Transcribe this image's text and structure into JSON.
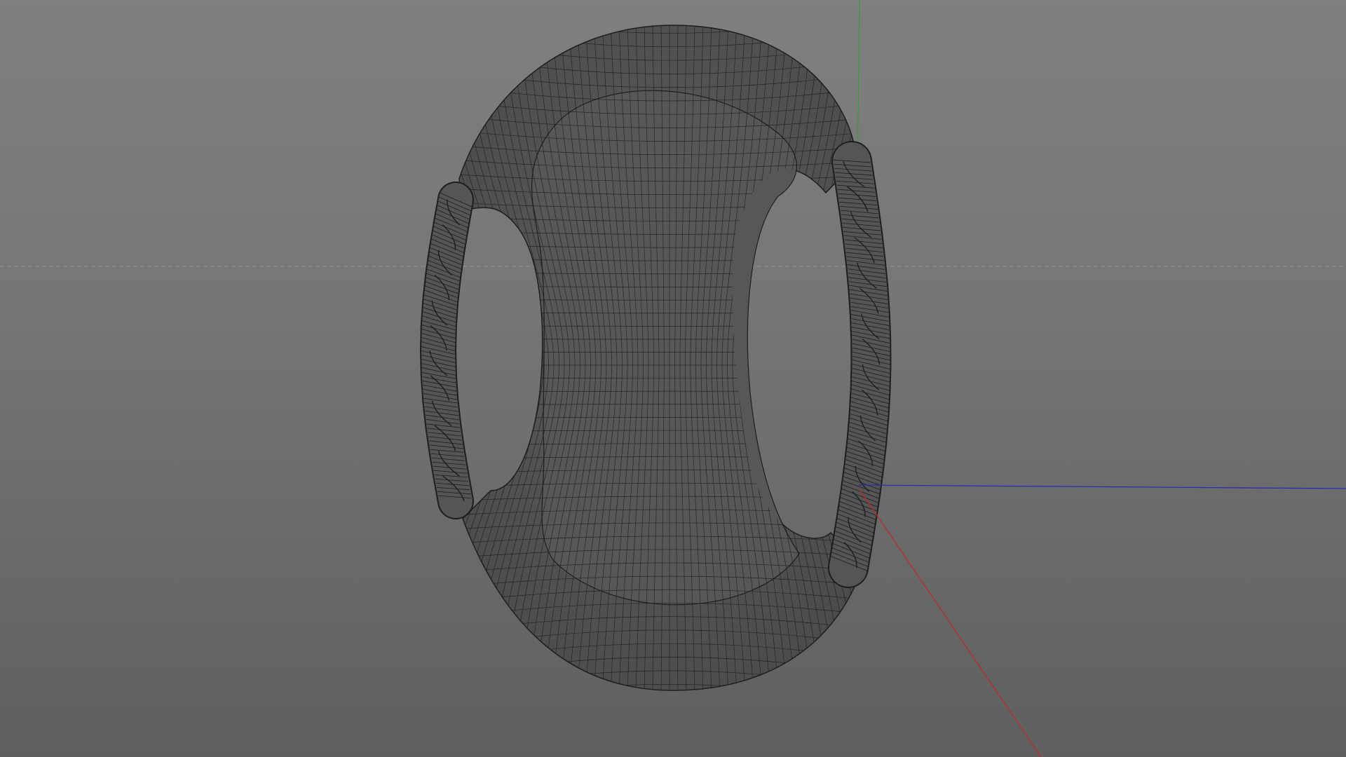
{
  "viewport": {
    "view": "perspective",
    "shading": "wireframe-on-shaded",
    "background_gradient": [
      "#7f7f7f",
      "#5f5f5f"
    ]
  },
  "scene": {
    "object": "torus-ring-with-twisted-rope-handles",
    "mesh_fill": "#555555",
    "wire_color": "#1e1e1e",
    "axes": {
      "x_color": "#c02a2a",
      "y_color": "#3c9a3c",
      "z_color": "#2a2ab0"
    },
    "horizon_line_color": "#9a9a9a"
  }
}
